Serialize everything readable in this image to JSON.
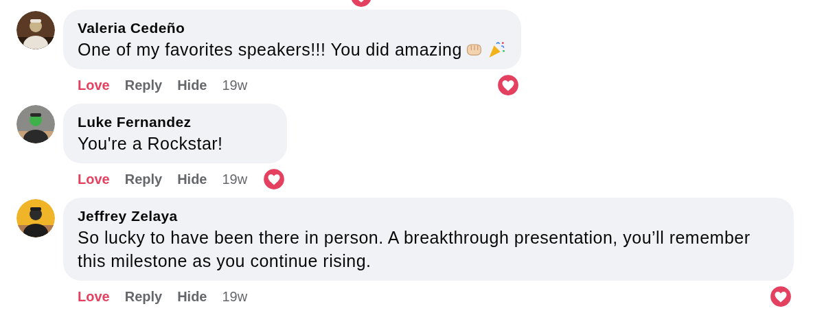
{
  "previous_reaction": {
    "kind": "love"
  },
  "comments": [
    {
      "author": "Valeria Cedeño",
      "text": "One of my favorites speakers!!! You did amazing",
      "emojis": [
        {
          "kind": "fist"
        },
        {
          "kind": "party_popper"
        }
      ],
      "actions": {
        "love": "Love",
        "loved": true,
        "reply": "Reply",
        "hide": "Hide",
        "time": "19w"
      },
      "reaction": {
        "kind": "love"
      },
      "avatar": {
        "kind": "picture"
      }
    },
    {
      "author": "Luke Fernandez",
      "text": "You're a Rockstar!",
      "actions": {
        "love": "Love",
        "loved": true,
        "reply": "Reply",
        "hide": "Hide",
        "time": "19w"
      },
      "reaction": {
        "kind": "love"
      },
      "avatar": {
        "kind": "picture"
      }
    },
    {
      "author": "Jeffrey Zelaya",
      "text": "So lucky to have been there in person. A breakthrough presentation, you’ll remember this milestone as you continue rising.",
      "actions": {
        "love": "Love",
        "loved": true,
        "reply": "Reply",
        "hide": "Hide",
        "time": "19w"
      },
      "reaction": {
        "kind": "love"
      },
      "avatar": {
        "kind": "picture"
      }
    }
  ]
}
